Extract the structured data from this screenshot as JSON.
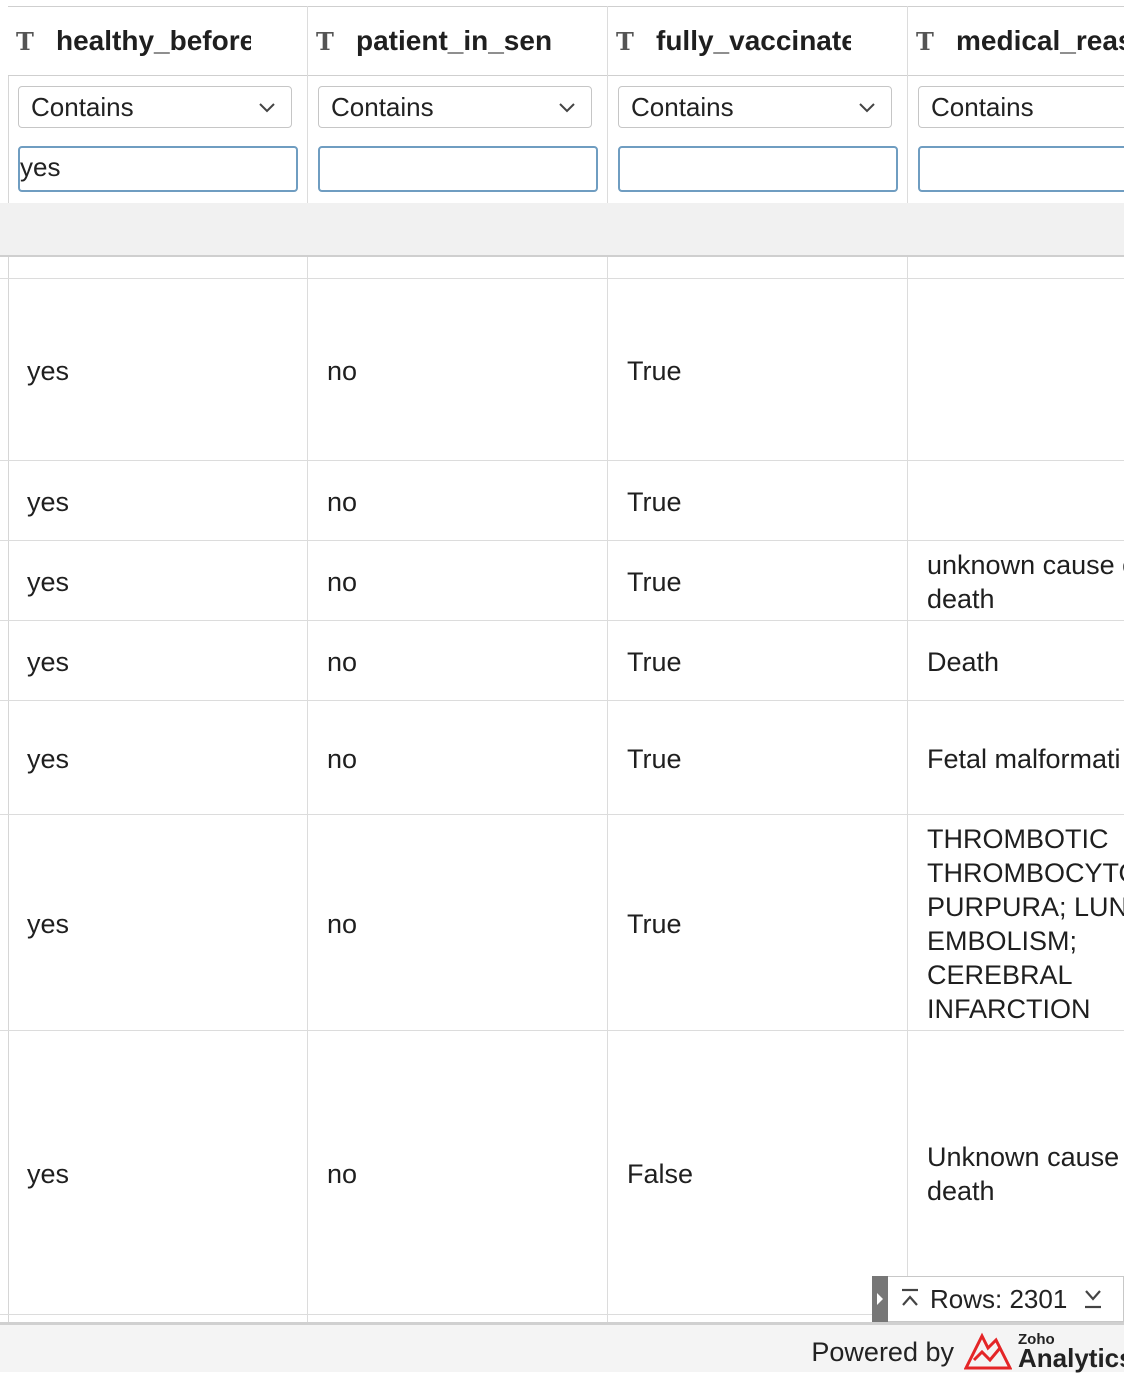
{
  "columns": [
    {
      "type_icon": "T",
      "title": "healthy_before_",
      "filter_op": "Contains",
      "filter_value": "yes"
    },
    {
      "type_icon": "T",
      "title": "patient_in_senic",
      "filter_op": "Contains",
      "filter_value": ""
    },
    {
      "type_icon": "T",
      "title": "fully_vaccinatec",
      "filter_op": "Contains",
      "filter_value": ""
    },
    {
      "type_icon": "T",
      "title": "medical_reaso",
      "filter_op": "Contains",
      "filter_value": ""
    }
  ],
  "rows": [
    {
      "c0": "yes",
      "c1": "no",
      "c2": "True",
      "c3": ""
    },
    {
      "c0": "yes",
      "c1": "no",
      "c2": "True",
      "c3": ""
    },
    {
      "c0": "yes",
      "c1": "no",
      "c2": "True",
      "c3": "unknown cause o\ndeath"
    },
    {
      "c0": "yes",
      "c1": "no",
      "c2": "True",
      "c3": "Death"
    },
    {
      "c0": "yes",
      "c1": "no",
      "c2": "True",
      "c3": "Fetal malformati"
    },
    {
      "c0": "yes",
      "c1": "no",
      "c2": "True",
      "c3": "THROMBOTIC\nTHROMBOCYTO\nPURPURA; LUNG\nEMBOLISM;\nCEREBRAL\nINFARCTION"
    },
    {
      "c0": "yes",
      "c1": "no",
      "c2": "False",
      "c3": "Unknown cause\ndeath"
    }
  ],
  "footer": {
    "rows_label": "Rows: 2301",
    "powered_by": "Powered by",
    "brand_small": "Zoho",
    "brand_big": "Analytics"
  },
  "icons": [
    "chevron-down-icon",
    "scroll-to-top-icon",
    "scroll-to-bottom-icon",
    "expand-handle-icon",
    "zoho-analytics-logo"
  ]
}
